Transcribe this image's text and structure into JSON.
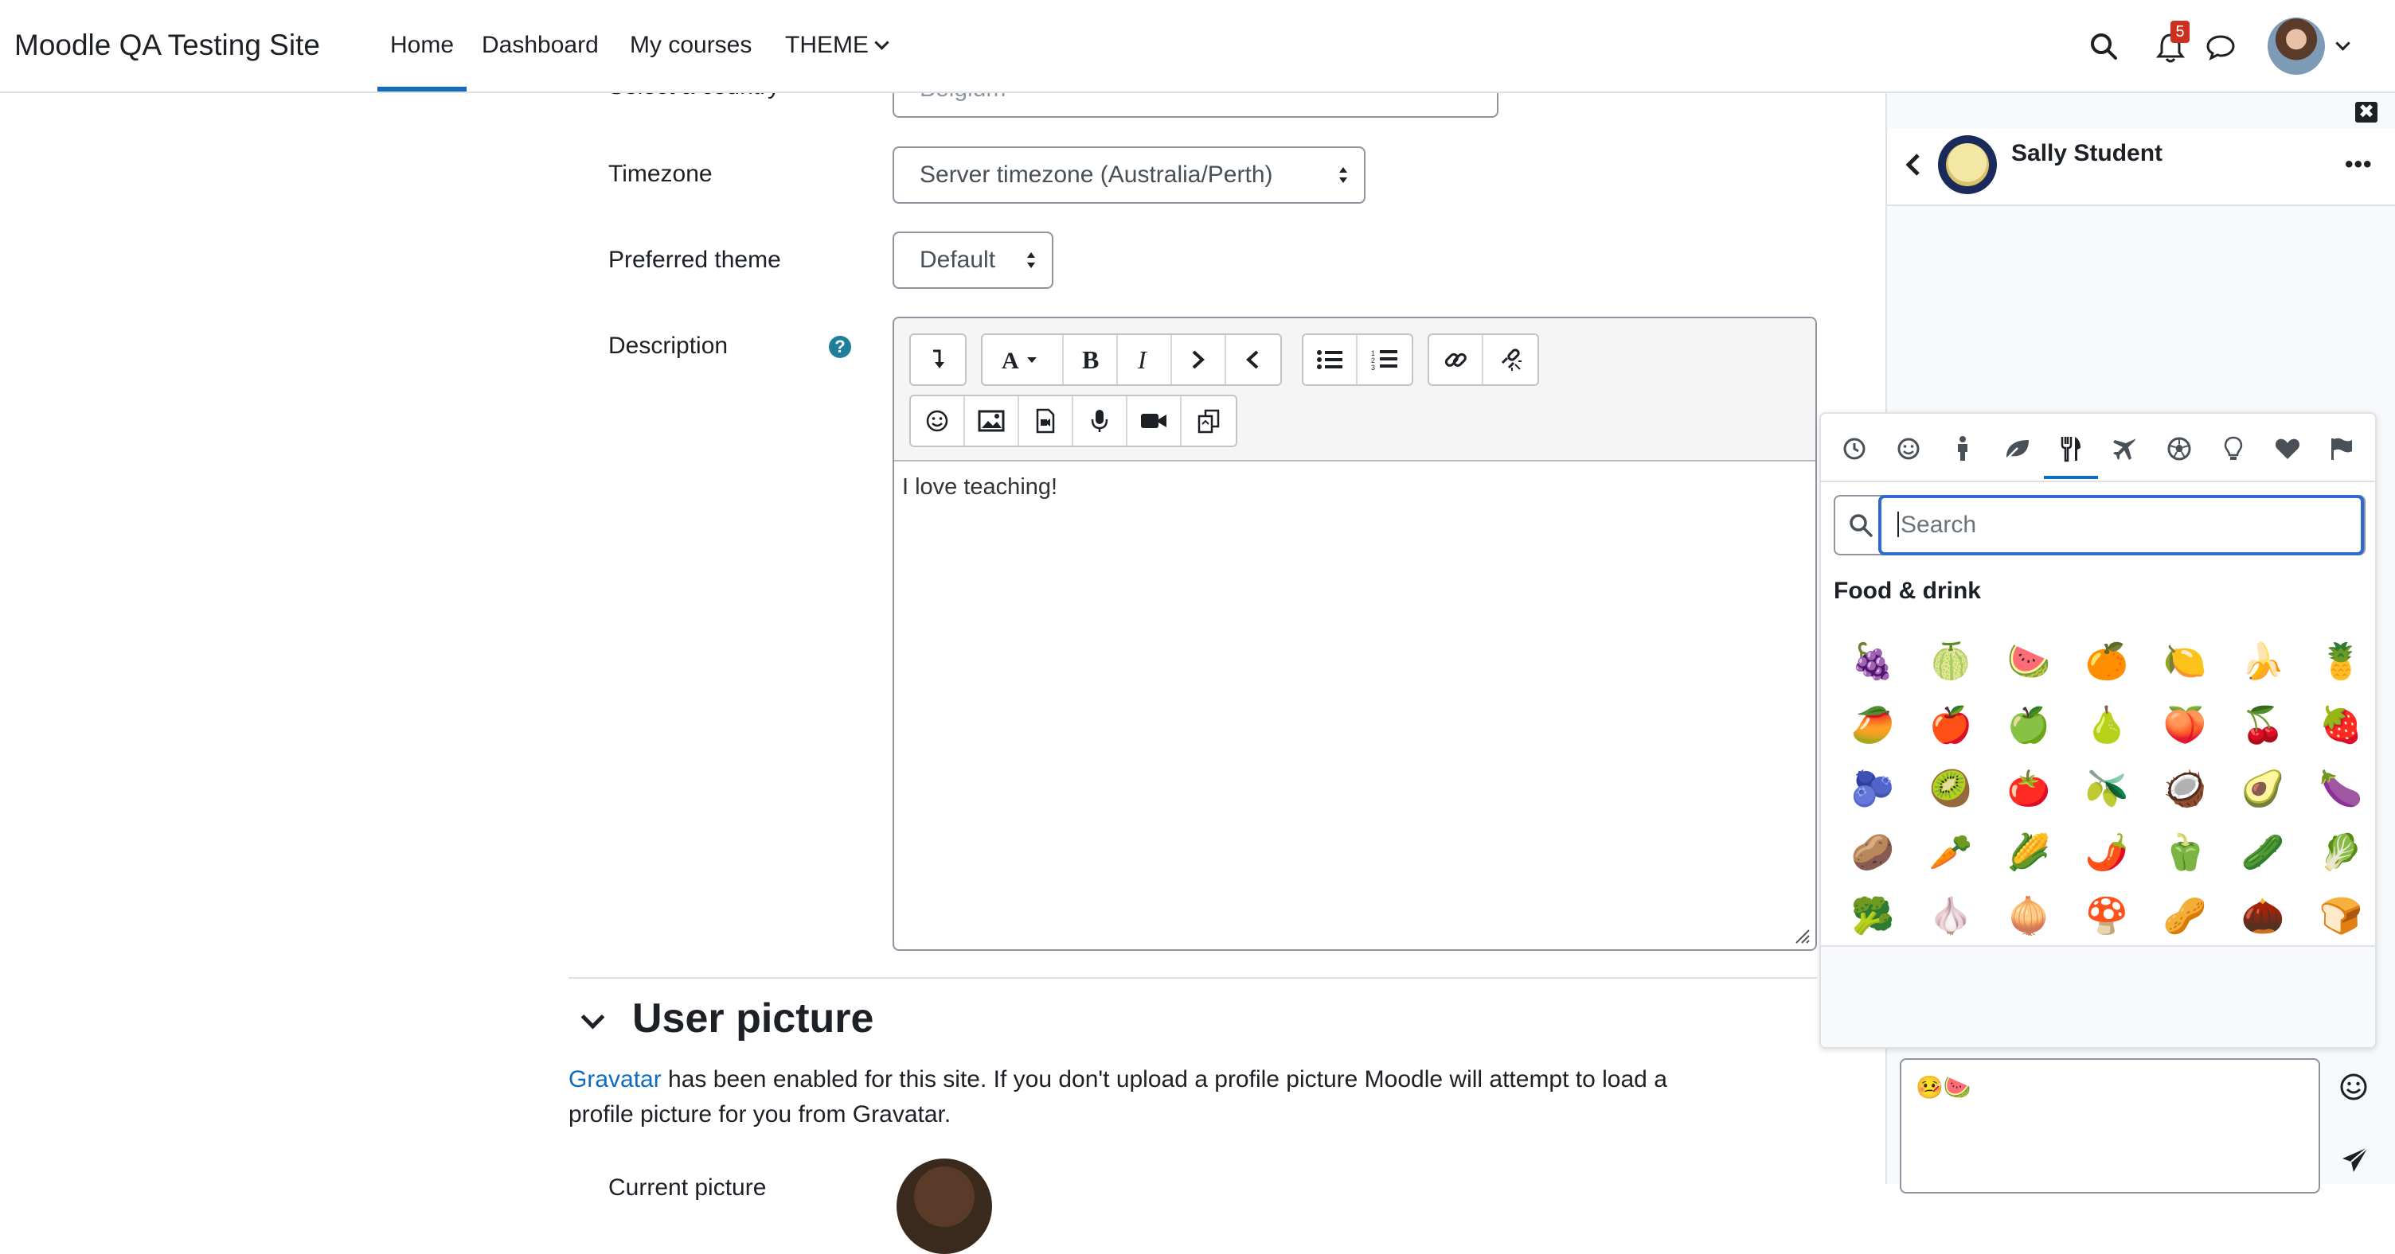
{
  "navbar": {
    "site_name": "Moodle QA Testing Site",
    "links": [
      "Home",
      "Dashboard",
      "My courses",
      "THEME"
    ],
    "notification_count": "5"
  },
  "form": {
    "country_label": "Select a country",
    "country_value": "Belgium",
    "timezone_label": "Timezone",
    "timezone_value": "Server timezone (Australia/Perth)",
    "theme_label": "Preferred theme",
    "theme_value": "Default",
    "description_label": "Description",
    "help_icon": "?",
    "description_text": "I love teaching!"
  },
  "user_picture": {
    "title": "User picture",
    "gravatar_link": "Gravatar",
    "line1": " has been enabled for this site. If you don't upload a profile picture Moodle will attempt to load a",
    "line2": "profile picture for you from Gravatar.",
    "current_picture_label": "Current picture"
  },
  "drawer": {
    "contact_name": "Sally Student",
    "menu": "•••",
    "close": "✖"
  },
  "emoji_picker": {
    "search_placeholder": "Search",
    "category_title": "Food & drink",
    "emojis": [
      "🍇",
      "🍈",
      "🍉",
      "🍊",
      "🍋",
      "🍌",
      "🍍",
      "🥭",
      "🍎",
      "🍏",
      "🍐",
      "🍑",
      "🍒",
      "🍓",
      "🫐",
      "🥝",
      "🍅",
      "🫒",
      "🥥",
      "🥑",
      "🍆",
      "🥔",
      "🥕",
      "🌽",
      "🌶️",
      "🫑",
      "🥒",
      "🥬",
      "🥦",
      "🧄",
      "🧅",
      "🍄",
      "🥜",
      "🌰",
      "🍞"
    ]
  },
  "message": {
    "draft": "🤒🍉"
  },
  "colors": {
    "accent": "#0f6cbf",
    "badge": "#ca3120",
    "focus_border": "#2e6bd1"
  }
}
